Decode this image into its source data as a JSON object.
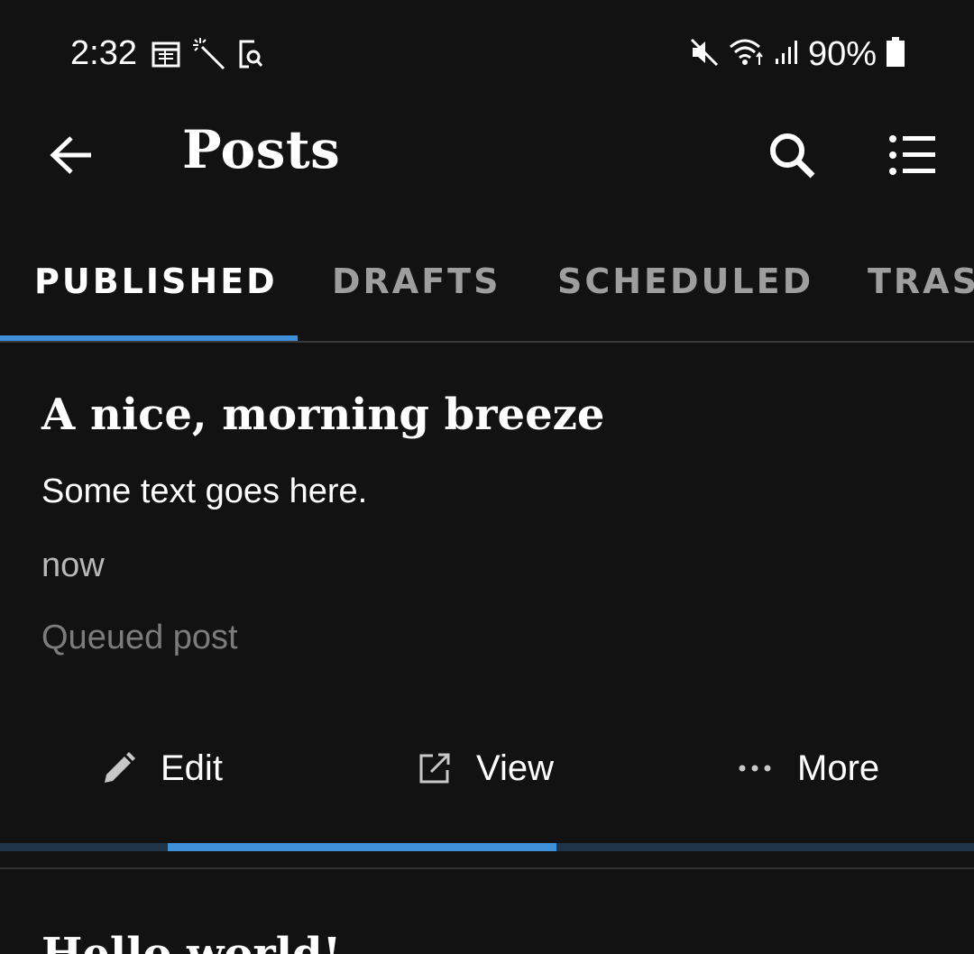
{
  "status_bar": {
    "time": "2:32",
    "battery": "90%",
    "left_icons": [
      "calendar-icon",
      "magic-wand-icon",
      "screen-search-icon"
    ],
    "right_icons": [
      "mute-icon",
      "wifi-icon",
      "signal-icon",
      "battery-icon"
    ]
  },
  "toolbar": {
    "title": "Posts",
    "icons": [
      "back-arrow-icon",
      "search-icon",
      "list-icon"
    ]
  },
  "tabs": {
    "items": [
      {
        "label": "PUBLISHED",
        "active": true
      },
      {
        "label": "DRAFTS",
        "active": false
      },
      {
        "label": "SCHEDULED",
        "active": false
      },
      {
        "label": "TRASHED",
        "active": false
      }
    ]
  },
  "post": {
    "title": "A nice, morning breeze",
    "excerpt": "Some text goes here.",
    "date": "now",
    "status": "Queued post",
    "actions": {
      "edit": "Edit",
      "view": "View",
      "more": "More"
    }
  },
  "upload_progress": {
    "fill_start_fraction": 0.172,
    "fill_end_fraction": 0.571
  },
  "next_post": {
    "title": "Hello world!"
  },
  "colors": {
    "background": "#121212",
    "accent": "#3f8fd9",
    "tab_inactive": "#9e9e9e",
    "muted_text": "#7c7c7c"
  }
}
